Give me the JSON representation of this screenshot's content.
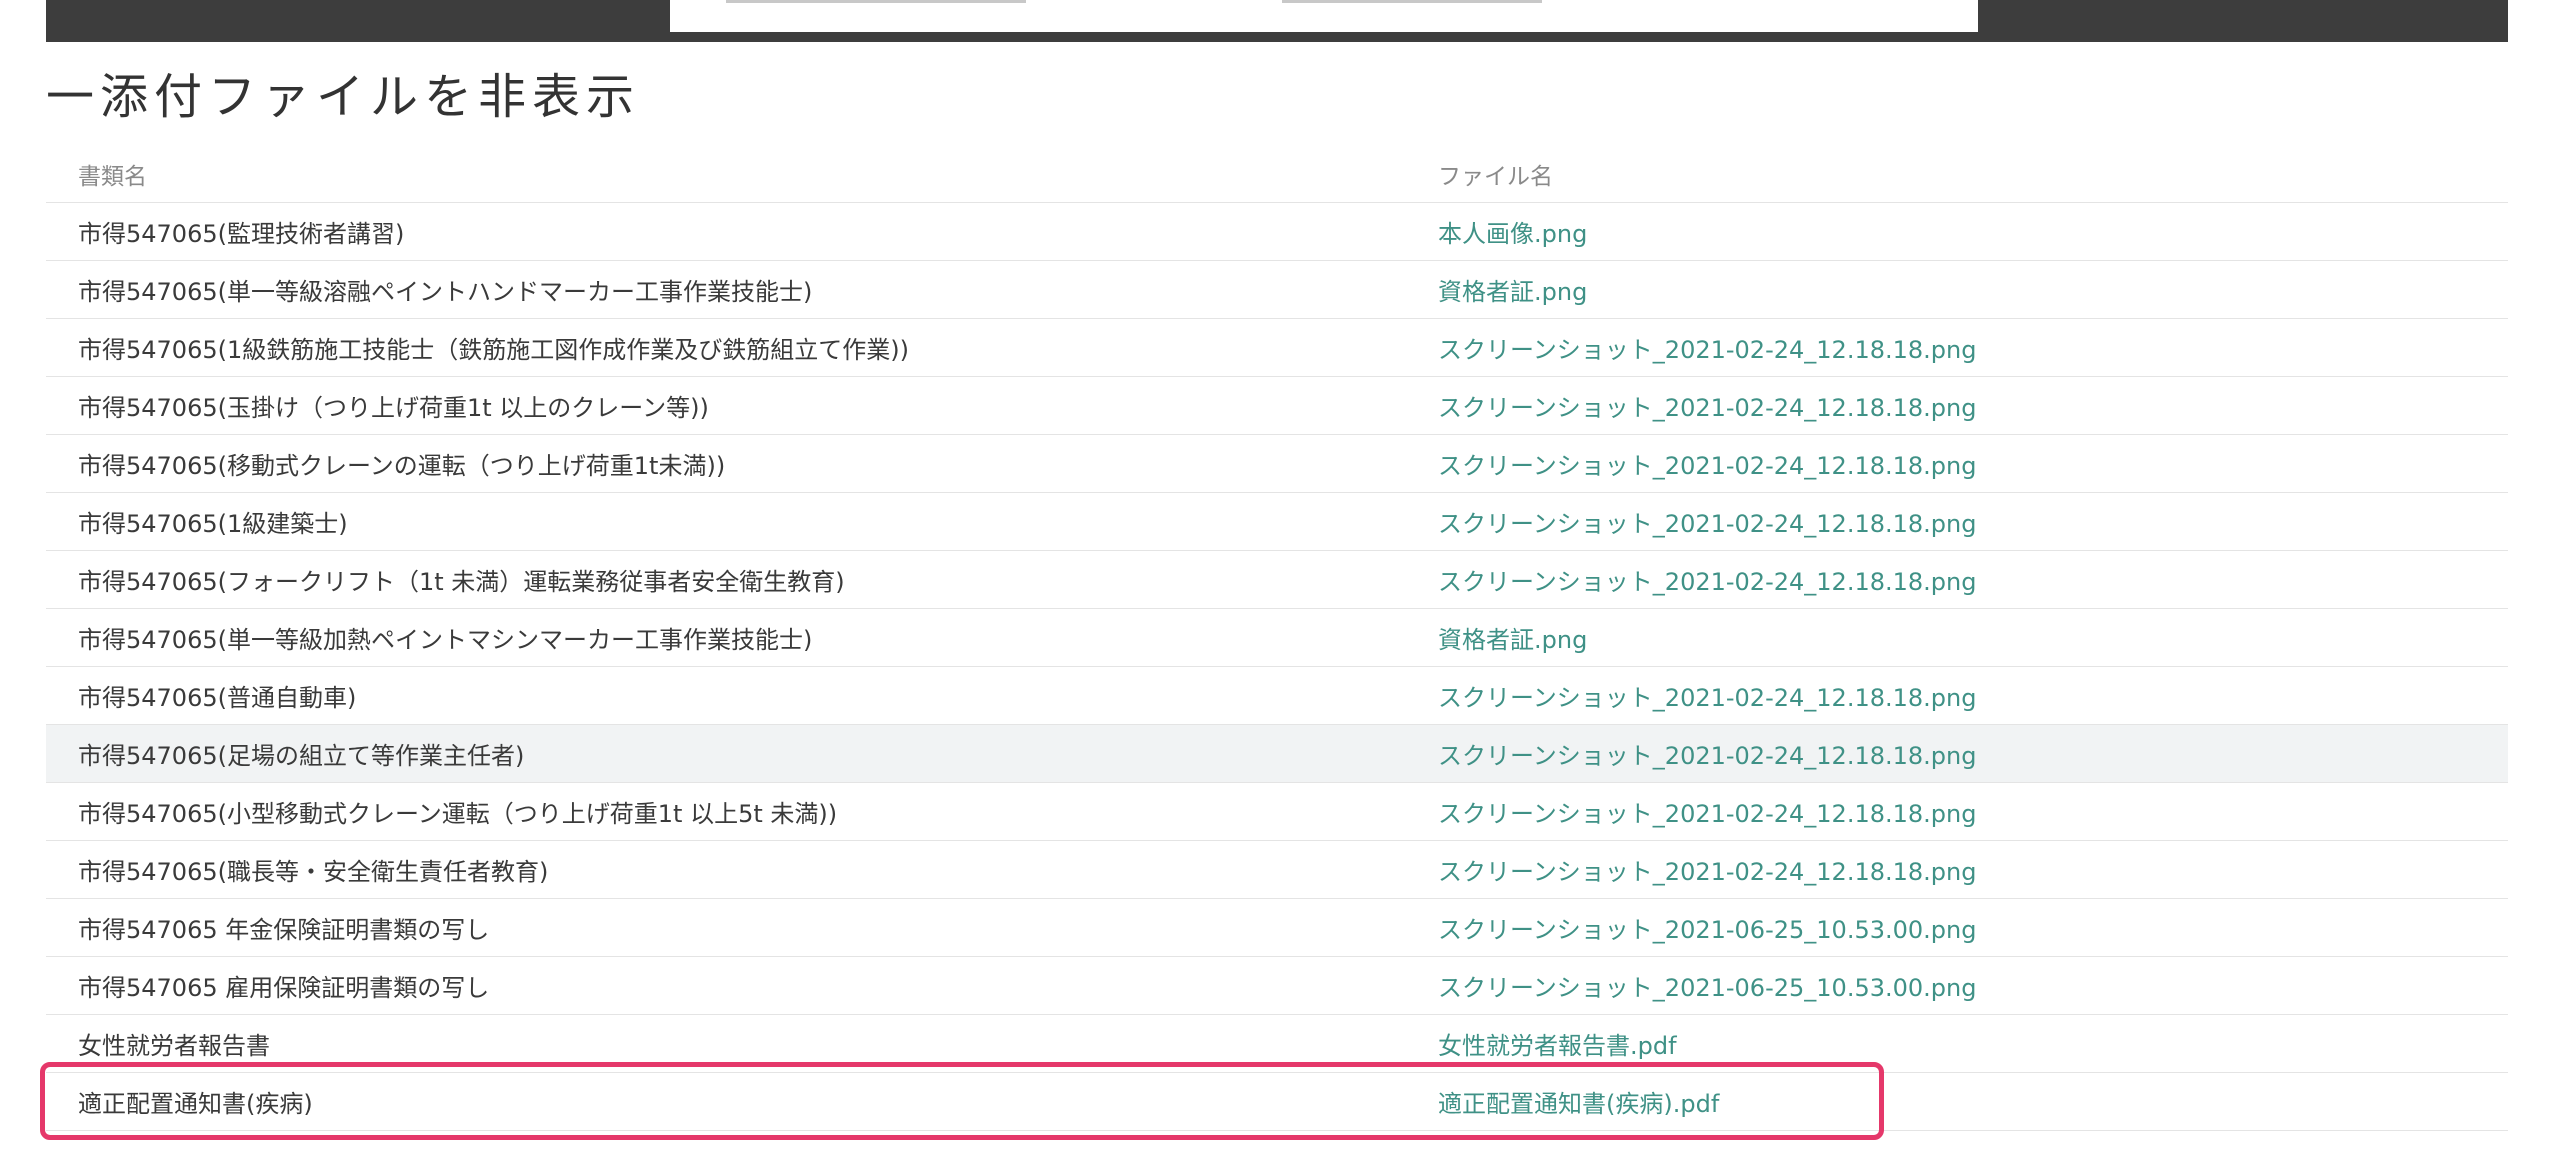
{
  "attachments": {
    "toggle_label": "一添付ファイルを非表示",
    "columns": {
      "doc_type": "書類名",
      "file_name": "ファイル名"
    },
    "rows": [
      {
        "doc_type": "市得547065(監理技術者講習)",
        "file_name": "本人画像.png"
      },
      {
        "doc_type": "市得547065(単一等級溶融ペイントハンドマーカー工事作業技能士)",
        "file_name": "資格者証.png"
      },
      {
        "doc_type": "市得547065(1級鉄筋施工技能士（鉄筋施工図作成作業及び鉄筋組立て作業))",
        "file_name": "スクリーンショット_2021-02-24_12.18.18.png"
      },
      {
        "doc_type": "市得547065(玉掛け（つり上げ荷重1t 以上のクレーン等))",
        "file_name": "スクリーンショット_2021-02-24_12.18.18.png"
      },
      {
        "doc_type": "市得547065(移動式クレーンの運転（つり上げ荷重1t未満))",
        "file_name": "スクリーンショット_2021-02-24_12.18.18.png"
      },
      {
        "doc_type": "市得547065(1級建築士)",
        "file_name": "スクリーンショット_2021-02-24_12.18.18.png"
      },
      {
        "doc_type": "市得547065(フォークリフト（1t 未満）運転業務従事者安全衛生教育)",
        "file_name": "スクリーンショット_2021-02-24_12.18.18.png"
      },
      {
        "doc_type": "市得547065(単一等級加熱ペイントマシンマーカー工事作業技能士)",
        "file_name": "資格者証.png"
      },
      {
        "doc_type": "市得547065(普通自動車)",
        "file_name": "スクリーンショット_2021-02-24_12.18.18.png"
      },
      {
        "doc_type": "市得547065(足場の組立て等作業主任者)",
        "file_name": "スクリーンショット_2021-02-24_12.18.18.png"
      },
      {
        "doc_type": "市得547065(小型移動式クレーン運転（つり上げ荷重1t 以上5t 未満))",
        "file_name": "スクリーンショット_2021-02-24_12.18.18.png"
      },
      {
        "doc_type": "市得547065(職長等・安全衛生責任者教育)",
        "file_name": "スクリーンショット_2021-02-24_12.18.18.png"
      },
      {
        "doc_type": "市得547065 年金保険証明書類の写し",
        "file_name": "スクリーンショット_2021-06-25_10.53.00.png"
      },
      {
        "doc_type": "市得547065 雇用保険証明書類の写し",
        "file_name": "スクリーンショット_2021-06-25_10.53.00.png"
      },
      {
        "doc_type": "女性就労者報告書",
        "file_name": "女性就労者報告書.pdf"
      },
      {
        "doc_type": "適正配置通知書(疾病)",
        "file_name": "適正配置通知書(疾病).pdf"
      }
    ]
  },
  "colors": {
    "link": "#3f9186",
    "highlight_frame": "#e5386a",
    "hover_row": "#f1f3f4"
  }
}
